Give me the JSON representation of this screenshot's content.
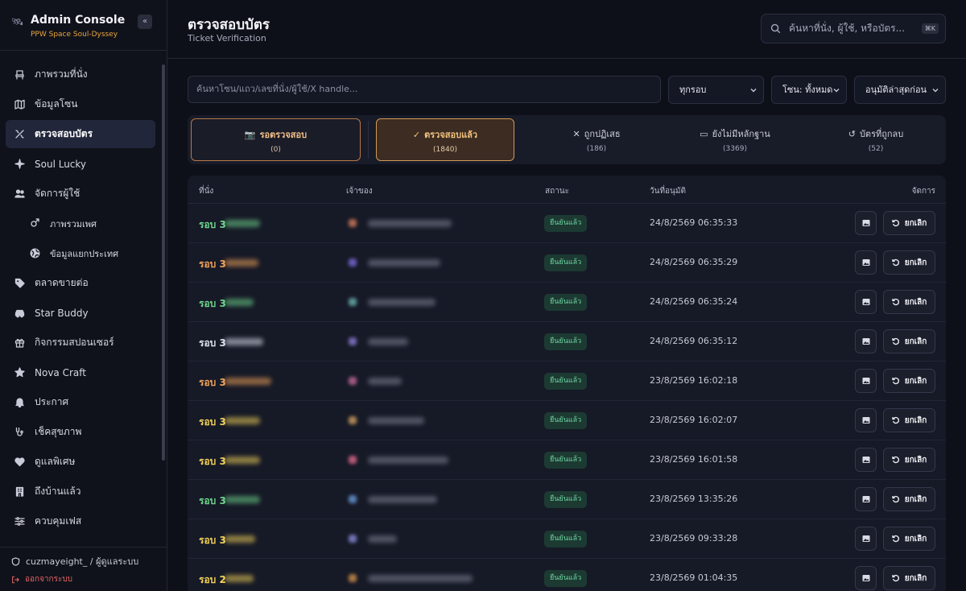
{
  "sidebar": {
    "title": "Admin Console",
    "subtitle": "PPW Space Soul-Dyssey",
    "collapse": "«",
    "items": [
      {
        "label": "ภาพรวมที่นั่ง",
        "icon": "seat-icon"
      },
      {
        "label": "ข้อมูลโซน",
        "icon": "map-icon"
      },
      {
        "label": "ตรวจสอบบัตร",
        "icon": "ticket-check-icon",
        "active": true
      },
      {
        "label": "Soul Lucky",
        "icon": "sparkle-icon"
      },
      {
        "label": "จัดการผู้ใช้",
        "icon": "users-icon"
      },
      {
        "label": "ภาพรวมเพศ",
        "icon": "gender-icon",
        "sub": true
      },
      {
        "label": "ข้อมูลแยกประเทศ",
        "icon": "globe-icon",
        "sub": true
      },
      {
        "label": "ตลาดขายต่อ",
        "icon": "tag-icon"
      },
      {
        "label": "Star Buddy",
        "icon": "car-icon"
      },
      {
        "label": "กิจกรรมสปอนเซอร์",
        "icon": "gift-icon"
      },
      {
        "label": "Nova Craft",
        "icon": "star-icon"
      },
      {
        "label": "ประกาศ",
        "icon": "bell-icon"
      },
      {
        "label": "เช็คสุขภาพ",
        "icon": "stethoscope-icon"
      },
      {
        "label": "ดูแลพิเศษ",
        "icon": "heart-icon"
      },
      {
        "label": "ถึงบ้านแล้ว",
        "icon": "building-icon"
      },
      {
        "label": "ควบคุมเฟส",
        "icon": "sliders-icon"
      }
    ],
    "user": "cuzmayeight_ / ผู้ดูแลระบบ",
    "logout": "ออกจากระบบ"
  },
  "header": {
    "title": "ตรวจสอบบัตร",
    "subtitle": "Ticket Verification",
    "search_placeholder": "ค้นหาที่นั่ง, ผู้ใช้, หรือบัตร...",
    "shortcut": "⌘K"
  },
  "filters": {
    "search_placeholder": "ค้นหาโซน/แถว/เลขที่นั่ง/ผู้ใช้/X handle...",
    "round": "ทุกรอบ",
    "zone": "โซน: ทั้งหมด",
    "sort": "อนุมัติล่าสุดก่อน"
  },
  "tabs": [
    {
      "label": "รอตรวจสอบ",
      "count": "(0)",
      "icon": "camera-icon"
    },
    {
      "label": "ตรวจสอบแล้ว",
      "count": "(1840)",
      "icon": "check-icon"
    },
    {
      "label": "ถูกปฏิเสธ",
      "count": "(186)",
      "icon": "x-icon"
    },
    {
      "label": "ยังไม่มีหลักฐาน",
      "count": "(3369)",
      "icon": "inbox-icon"
    },
    {
      "label": "บัตรที่ถูกลบ",
      "count": "(52)",
      "icon": "undo-icon"
    }
  ],
  "table": {
    "columns": {
      "seat": "ที่นั่ง",
      "owner": "เจ้าของ",
      "status": "สถานะ",
      "date": "วันที่อนุมัติ",
      "actions": "จัดการ"
    },
    "status_label": "ยืนยันแล้ว",
    "cancel_label": "ยกเลิก",
    "rows": [
      {
        "seat": "รอบ 3",
        "date": "24/8/2569 06:35:33",
        "seat_color": "#6fd58c",
        "avatar_color": "#d07a5a"
      },
      {
        "seat": "รอบ 3",
        "date": "24/8/2569 06:35:29",
        "seat_color": "#f0a45a",
        "avatar_color": "#7a6ad8"
      },
      {
        "seat": "รอบ 3",
        "date": "24/8/2569 06:35:24",
        "seat_color": "#6fd58c",
        "avatar_color": "#6ab0b0"
      },
      {
        "seat": "รอบ 3",
        "date": "24/8/2569 06:35:12",
        "seat_color": "#dfe3f0",
        "avatar_color": "#8a7ad0"
      },
      {
        "seat": "รอบ 3",
        "date": "23/8/2569 16:02:18",
        "seat_color": "#f0a45a",
        "avatar_color": "#c46a9a"
      },
      {
        "seat": "รอบ 3",
        "date": "23/8/2569 16:02:07",
        "seat_color": "#f1d25a",
        "avatar_color": "#d0a060"
      },
      {
        "seat": "รอบ 3",
        "date": "23/8/2569 16:01:58",
        "seat_color": "#f1d25a",
        "avatar_color": "#e06a8a"
      },
      {
        "seat": "รอบ 3",
        "date": "23/8/2569 13:35:26",
        "seat_color": "#6fd58c",
        "avatar_color": "#6a9ad8"
      },
      {
        "seat": "รอบ 3",
        "date": "23/8/2569 09:33:28",
        "seat_color": "#f1d25a",
        "avatar_color": "#8a8ad8"
      },
      {
        "seat": "รอบ 2",
        "date": "23/8/2569 01:04:35",
        "seat_color": "#f1d25a",
        "avatar_color": "#d0904a"
      }
    ]
  }
}
